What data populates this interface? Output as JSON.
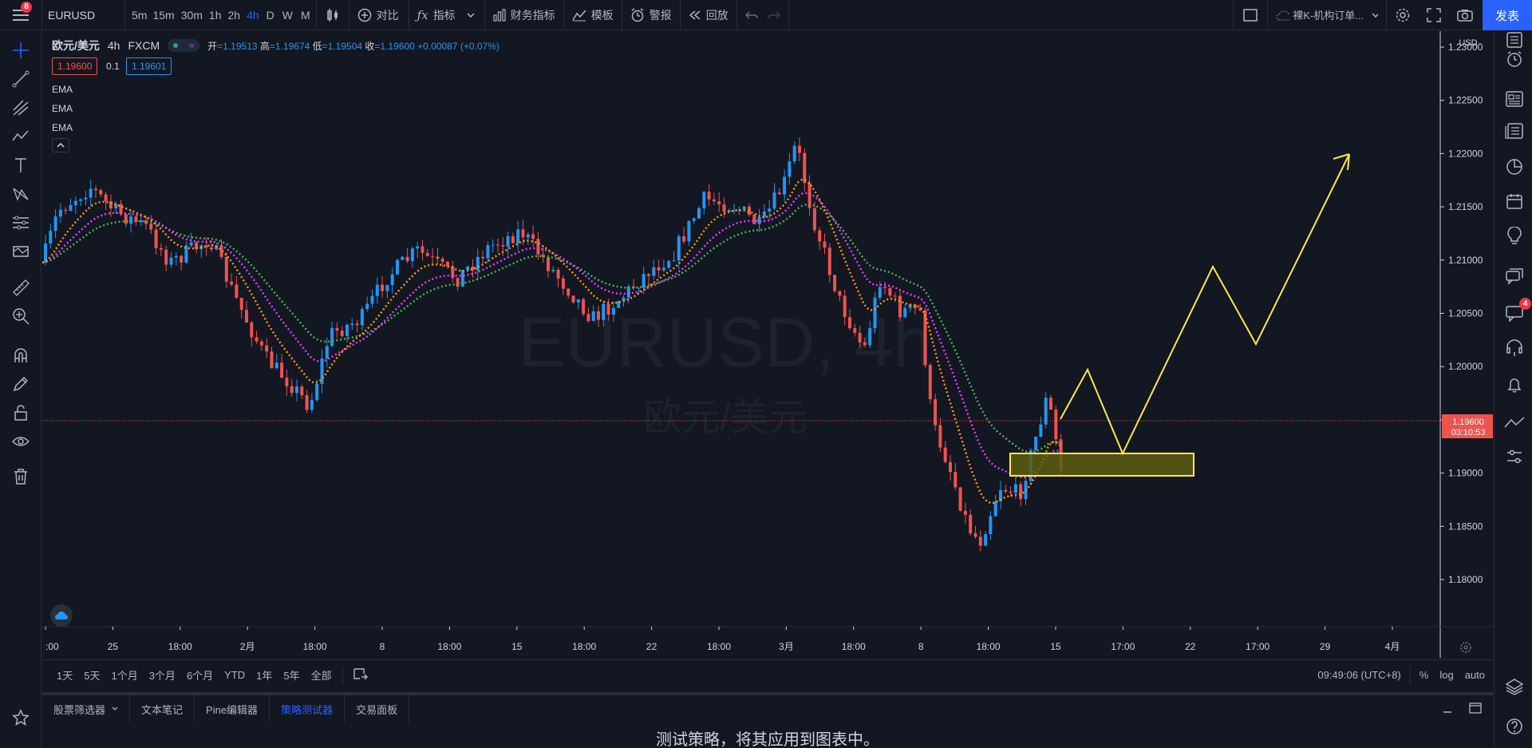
{
  "topbar": {
    "menu_badge": "8",
    "symbol": "EURUSD",
    "intervals": [
      "5m",
      "15m",
      "30m",
      "1h",
      "2h",
      "4h",
      "D",
      "W",
      "M"
    ],
    "active_interval": "4h",
    "compare": "对比",
    "indicators": "指标",
    "financials": "财务指标",
    "templates": "模板",
    "alert": "警报",
    "replay": "回放",
    "layout_name": "裸K-机构订单...",
    "publish": "发表"
  },
  "legend": {
    "title": "欧元/美元",
    "interval": "4h",
    "source": "FXCM",
    "open_label": "开",
    "open": "=1.19513",
    "high_label": "高",
    "high": "=1.19674",
    "low_label": "低",
    "low": "=1.19504",
    "close_label": "收",
    "close": "=1.19600",
    "change": "+0.00087 (+0.07%)",
    "bid": "1.19600",
    "spread": "0.1",
    "ask": "1.19601",
    "indicators": [
      "EMA",
      "EMA",
      "EMA"
    ]
  },
  "watermark": {
    "symbol": "EURUSD, 4h",
    "name": "欧元/美元"
  },
  "price_axis": {
    "currency": "USD",
    "ticks": [
      "1.23000",
      "1.22500",
      "1.22000",
      "1.21500",
      "1.21000",
      "1.20500",
      "1.20000",
      "1.19500",
      "1.19000",
      "1.18500",
      "1.18000"
    ],
    "last_price": "1.19600",
    "countdown": "03:10:53"
  },
  "time_axis": {
    "ticks": [
      ":00",
      "25",
      "18:00",
      "2月",
      "18:00",
      "8",
      "18:00",
      "15",
      "18:00",
      "22",
      "18:00",
      "3月",
      "18:00",
      "8",
      "18:00",
      "15",
      "17:00",
      "22",
      "17:00",
      "29",
      "4月"
    ]
  },
  "ranges": [
    "1天",
    "5天",
    "1个月",
    "3个月",
    "6个月",
    "YTD",
    "1年",
    "5年",
    "全部"
  ],
  "clock": "09:49:06 (UTC+8)",
  "scale_opts": [
    "%",
    "log",
    "auto"
  ],
  "panel_tabs": [
    "股票筛选器",
    "文本笔记",
    "Pine编辑器",
    "策略测试器",
    "交易面板"
  ],
  "active_panel": "策略测试器",
  "panel_message": "测试策略，将其应用到图表中。",
  "right_badge": "4",
  "colors": {
    "bg": "#131722",
    "up": "#2196f3",
    "down": "#ef5350",
    "ema_fast": "#ff9800",
    "ema_mid": "#e040fb",
    "ema_slow": "#4caf50",
    "drawing": "#ffeb3b",
    "accent": "#2962ff"
  }
}
